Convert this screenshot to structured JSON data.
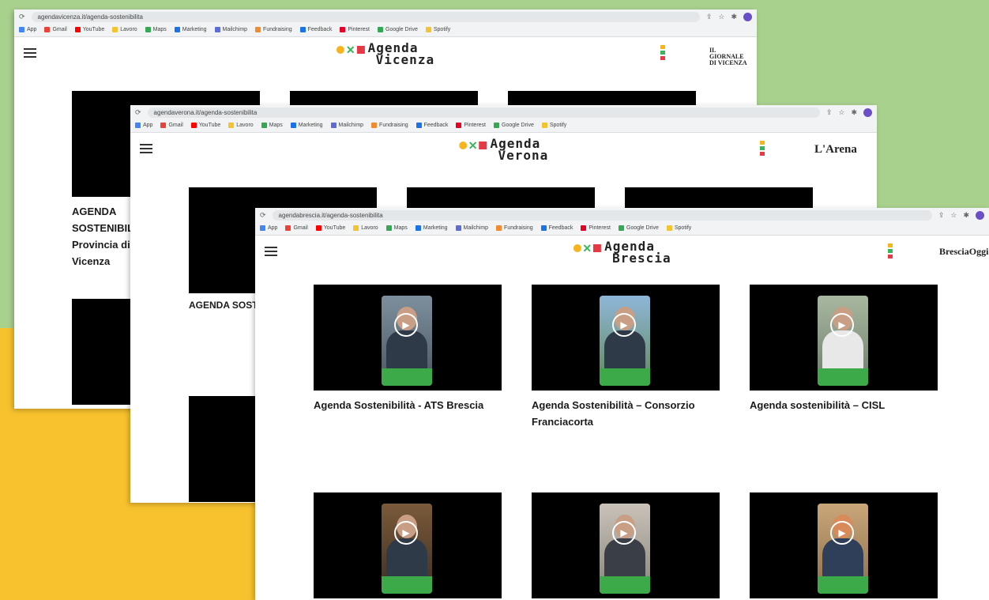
{
  "windows": [
    {
      "url": "agendavicenza.it/agenda-sostenibilita",
      "bookmarks": [
        "App",
        "Gmail",
        "YouTube",
        "Lavoro",
        "Maps",
        "Marketing",
        "Mailchimp",
        "Fundraising",
        "Feedback",
        "Pinterest",
        "Google Drive",
        "Spotify"
      ],
      "site": {
        "line1": "Agenda",
        "line2": "Vicenza",
        "newspaper": "IL GIORNALE DI VICENZA"
      },
      "cards": [
        {
          "title": "AGENDA SOSTENIBILITÀ – Provincia di Vicenza",
          "desc": ""
        }
      ]
    },
    {
      "url": "agendaverona.it/agenda-sostenibilita",
      "bookmarks": [
        "App",
        "Gmail",
        "YouTube",
        "Lavoro",
        "Maps",
        "Marketing",
        "Mailchimp",
        "Fundraising",
        "Feedback",
        "Pinterest",
        "Google Drive",
        "Spotify"
      ],
      "site": {
        "line1": "Agenda",
        "line2": "Verona",
        "newspaper": "L'Arena"
      },
      "cards": [
        {
          "title": "AGENDA SOSTENIBILITÀ",
          "desc": ""
        }
      ]
    },
    {
      "url": "agendabrescia.it/agenda-sostenibilita",
      "bookmarks": [
        "App",
        "Gmail",
        "YouTube",
        "Lavoro",
        "Maps",
        "Marketing",
        "Mailchimp",
        "Fundraising",
        "Feedback",
        "Pinterest",
        "Google Drive",
        "Spotify"
      ],
      "site": {
        "line1": "Agenda",
        "line2": "Brescia",
        "newspaper": "BresciaOggi"
      },
      "cards": [
        {
          "title": "Agenda Sostenibilità - ATS Brescia",
          "desc": ""
        },
        {
          "title": "Agenda Sostenibilità – Consorzio Franciacorta",
          "desc": ""
        },
        {
          "title": "Agenda sostenibilità – CISL",
          "desc": ""
        },
        {
          "title": "",
          "desc": ""
        },
        {
          "title": "",
          "desc": ""
        },
        {
          "title": "",
          "desc": ""
        }
      ]
    }
  ],
  "icons": {
    "menu": "hamburger-icon",
    "play": "play-icon"
  },
  "colors": {
    "green_bg": "#a9d18e",
    "yellow_bg": "#f8c22e",
    "logo_yellow": "#f6b41e",
    "logo_green": "#3bb55b",
    "logo_red": "#e63946",
    "video_band": "#3daa4a"
  }
}
